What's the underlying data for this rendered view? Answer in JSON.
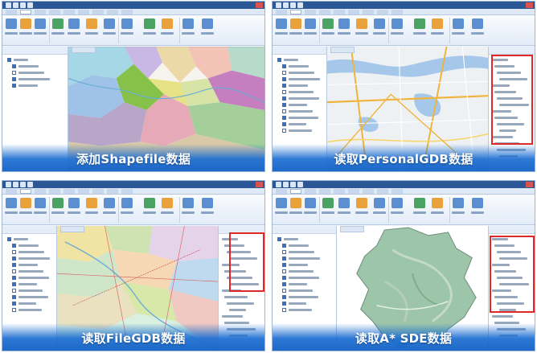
{
  "panels": [
    {
      "caption": "添加Shapefile数据"
    },
    {
      "caption": "读取PersonalGDB数据"
    },
    {
      "caption": "读取FileGDB数据"
    },
    {
      "caption": "读取A* SDE数据"
    }
  ],
  "colors": {
    "banner": "#1c6ed2",
    "highlight": "#e02828",
    "titlebar": "#2b5797"
  }
}
